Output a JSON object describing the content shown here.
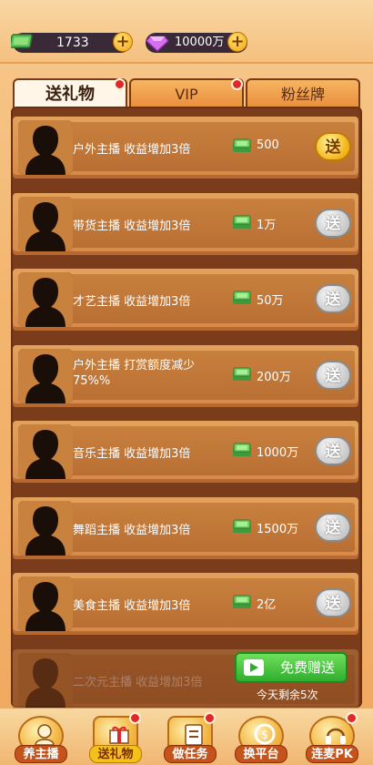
{
  "header": {
    "cash_value": "1733",
    "diamond_value": "10000万",
    "cash_add": "+",
    "diamond_add": "+"
  },
  "tabs": [
    {
      "label": "送礼物",
      "active": true,
      "has_dot": true
    },
    {
      "label": "VIP",
      "active": false,
      "has_dot": true
    },
    {
      "label": "粉丝牌",
      "active": false,
      "has_dot": false
    }
  ],
  "gifts": [
    {
      "title": "户外主播 收益增加3倍",
      "cost": "500",
      "button": "送",
      "style": "gold"
    },
    {
      "title": "带货主播 收益增加3倍",
      "cost": "1万",
      "button": "送",
      "style": "gray"
    },
    {
      "title": "才艺主播 收益增加3倍",
      "cost": "50万",
      "button": "送",
      "style": "gray"
    },
    {
      "title": "户外主播 打赏额度减少75%%",
      "cost": "200万",
      "button": "送",
      "style": "gray"
    },
    {
      "title": "音乐主播 收益增加3倍",
      "cost": "1000万",
      "button": "送",
      "style": "gray"
    },
    {
      "title": "舞蹈主播 收益增加3倍",
      "cost": "1500万",
      "button": "送",
      "style": "gray"
    },
    {
      "title": "美食主播 收益增加3倍",
      "cost": "2亿",
      "button": "送",
      "style": "gray"
    },
    {
      "title": "二次元主播 收益增加3倍",
      "cost": "",
      "button": "",
      "style": "faded"
    }
  ],
  "free_gift": {
    "label": "免费赠送",
    "remaining": "今天剩余5次"
  },
  "bottom_nav": [
    {
      "label": "养主播",
      "icon": "streamer-icon",
      "active": false,
      "dot": false
    },
    {
      "label": "送礼物",
      "icon": "gift-icon",
      "active": true,
      "dot": true
    },
    {
      "label": "做任务",
      "icon": "task-icon",
      "active": false,
      "dot": true
    },
    {
      "label": "换平台",
      "icon": "switch-platform-icon",
      "active": false,
      "dot": false
    },
    {
      "label": "连麦PK",
      "icon": "headset-icon",
      "active": false,
      "dot": true
    }
  ],
  "colors": {
    "background": "#f3b56e",
    "panel": "#7a3c1a",
    "row": "#d6894a",
    "gold_button": "#f2b318",
    "gray_button": "#c9c9c9",
    "green_button": "#2fae2d",
    "red_dot": "#e0282a"
  }
}
